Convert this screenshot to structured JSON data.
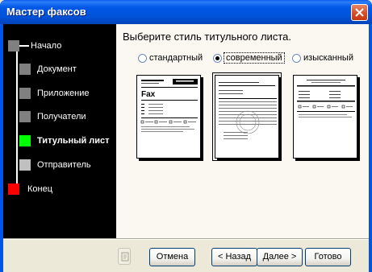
{
  "window": {
    "title": "Мастер факсов"
  },
  "sidebar": {
    "items": [
      {
        "label": "Начало",
        "color": "#808080",
        "active": false
      },
      {
        "label": "Документ",
        "color": "#808080",
        "active": false
      },
      {
        "label": "Приложение",
        "color": "#808080",
        "active": false
      },
      {
        "label": "Получатели",
        "color": "#808080",
        "active": false
      },
      {
        "label": "Титульный лист",
        "color": "#00FF00",
        "active": true
      },
      {
        "label": "Отправитель",
        "color": "#C0C0C0",
        "active": false
      },
      {
        "label": "Конец",
        "color": "#FF0000",
        "active": false
      }
    ]
  },
  "main": {
    "heading": "Выберите стиль титульного листа.",
    "options": [
      {
        "label": "стандартный",
        "selected": false
      },
      {
        "label": "современный",
        "selected": true
      },
      {
        "label": "изысканный",
        "selected": false
      }
    ],
    "thumb_text": {
      "fax": "Fax"
    }
  },
  "buttons": {
    "cancel": "Отмена",
    "back": "< Назад",
    "next": "Далее >",
    "finish": "Готово"
  },
  "colors": {
    "titlebar": "#0058E6",
    "active_step": "#00FF00",
    "end_step": "#FF0000"
  }
}
